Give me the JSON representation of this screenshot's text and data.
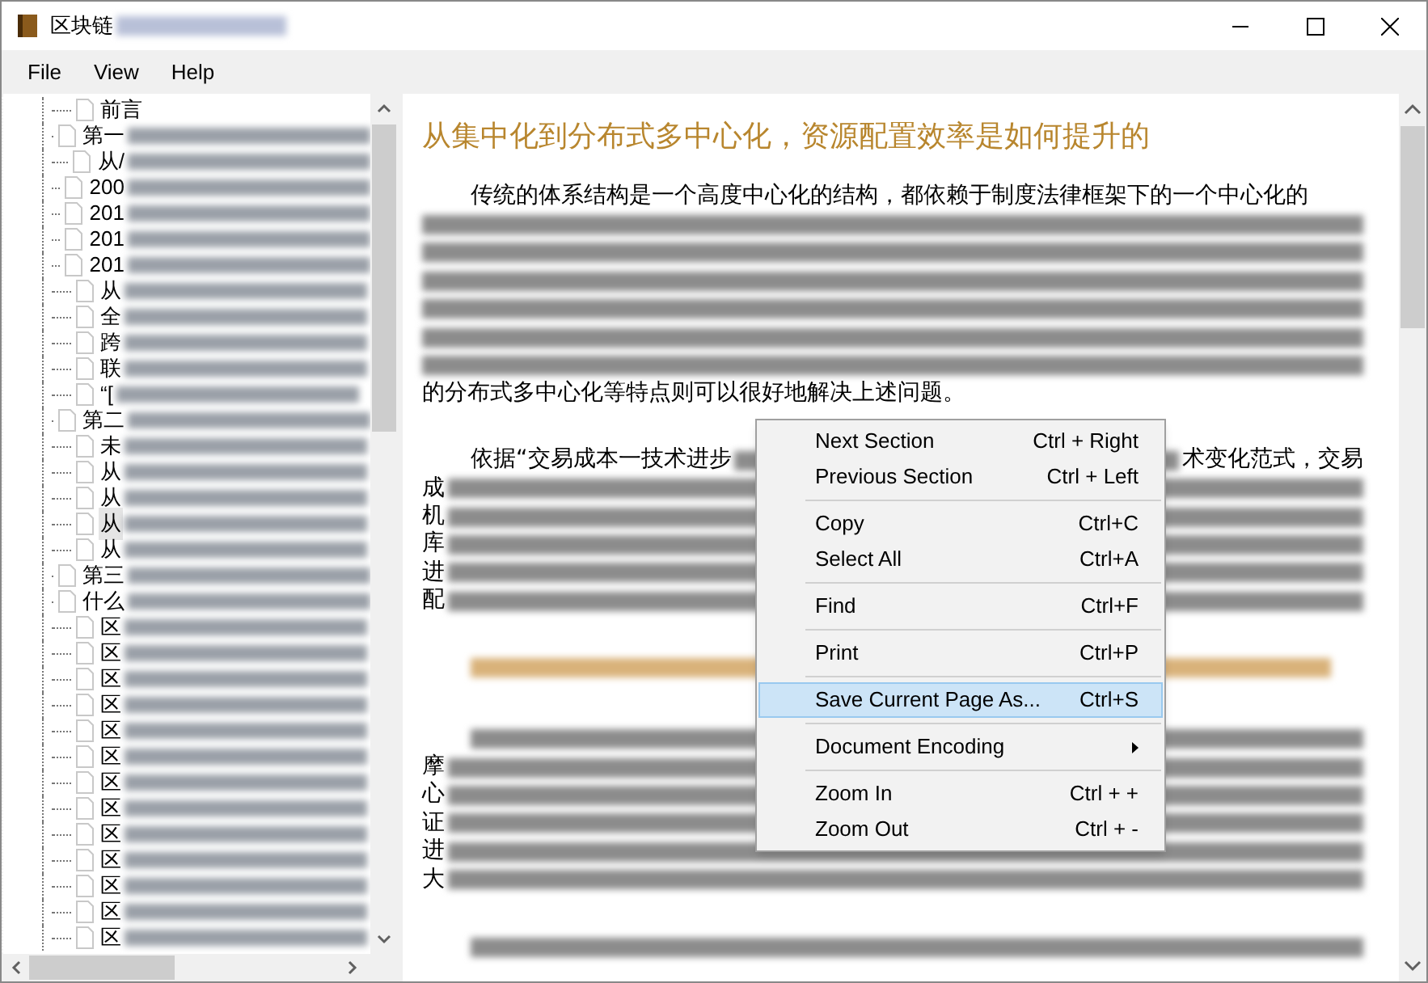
{
  "window": {
    "title": "区块链"
  },
  "menu_bar": [
    "File",
    "View",
    "Help"
  ],
  "tree": {
    "items": [
      {
        "text": "前言",
        "selected": false
      },
      {
        "text": "第一",
        "selected": false
      },
      {
        "text": "从/",
        "selected": false
      },
      {
        "text": "200",
        "selected": false
      },
      {
        "text": "201",
        "selected": false
      },
      {
        "text": "201",
        "selected": false
      },
      {
        "text": "201",
        "selected": false
      },
      {
        "text": "从",
        "selected": false
      },
      {
        "text": "全",
        "selected": false
      },
      {
        "text": "跨",
        "selected": false
      },
      {
        "text": "联",
        "selected": false
      },
      {
        "text": "“[",
        "selected": false
      },
      {
        "text": "第二",
        "selected": false
      },
      {
        "text": "未",
        "selected": false
      },
      {
        "text": "从",
        "selected": false
      },
      {
        "text": "从",
        "selected": false
      },
      {
        "text": "从",
        "selected": true
      },
      {
        "text": "从",
        "selected": false
      },
      {
        "text": "第三",
        "selected": false
      },
      {
        "text": "什么",
        "selected": false
      },
      {
        "text": "区",
        "selected": false
      },
      {
        "text": "区",
        "selected": false
      },
      {
        "text": "区",
        "selected": false
      },
      {
        "text": "区",
        "selected": false
      },
      {
        "text": "区",
        "selected": false
      },
      {
        "text": "区",
        "selected": false
      },
      {
        "text": "区",
        "selected": false
      },
      {
        "text": "区",
        "selected": false
      },
      {
        "text": "区",
        "selected": false
      },
      {
        "text": "区",
        "selected": false
      },
      {
        "text": "区",
        "selected": false
      },
      {
        "text": "区",
        "selected": false
      },
      {
        "text": "区",
        "selected": false
      }
    ]
  },
  "document": {
    "blocks": [
      {
        "kind": "heading",
        "text": "从集中化到分布式多中心化，资源配置效率是如何提升的"
      },
      {
        "kind": "paragraph",
        "lines": [
          [
            {
              "kind": "text",
              "text": "传统的体系结构是一个高度中心化的结构，都依赖于制度法律框架下的一个中心化的"
            }
          ],
          [
            {
              "kind": "blurred"
            }
          ],
          [
            {
              "kind": "blurred"
            }
          ],
          [
            {
              "kind": "blurred"
            }
          ],
          [
            {
              "kind": "blurred"
            }
          ],
          [
            {
              "kind": "blurred"
            }
          ],
          [
            {
              "kind": "blurred"
            }
          ],
          [
            {
              "kind": "text",
              "text": "的分布式多中心化等特点则可以很好地解决上述问题。"
            }
          ]
        ]
      },
      {
        "kind": "paragraph",
        "lines": [
          [
            {
              "kind": "text",
              "text": "依据“交易成本一技术进步"
            },
            {
              "kind": "blurred"
            },
            {
              "kind": "text",
              "text": "术变化范式，交易"
            }
          ],
          [
            {
              "kind": "text",
              "text": "成"
            },
            {
              "kind": "blurred"
            }
          ],
          [
            {
              "kind": "text",
              "text": "机"
            },
            {
              "kind": "blurred"
            }
          ],
          [
            {
              "kind": "text",
              "text": "库"
            },
            {
              "kind": "blurred"
            }
          ],
          [
            {
              "kind": "text",
              "text": "进"
            },
            {
              "kind": "blurred"
            }
          ],
          [
            {
              "kind": "text",
              "text": "配"
            },
            {
              "kind": "blurred"
            }
          ]
        ]
      },
      {
        "kind": "subheading"
      },
      {
        "kind": "paragraph",
        "lines": [
          [
            {
              "kind": "blurred"
            }
          ],
          [
            {
              "kind": "text",
              "text": "摩"
            },
            {
              "kind": "blurred"
            }
          ],
          [
            {
              "kind": "text",
              "text": "心"
            },
            {
              "kind": "blurred"
            }
          ],
          [
            {
              "kind": "text",
              "text": "证"
            },
            {
              "kind": "blurred"
            }
          ],
          [
            {
              "kind": "text",
              "text": "进"
            },
            {
              "kind": "blurred"
            }
          ],
          [
            {
              "kind": "text",
              "text": "大"
            },
            {
              "kind": "blurred"
            }
          ]
        ]
      },
      {
        "kind": "paragraph",
        "lines": [
          [
            {
              "kind": "blurred"
            }
          ]
        ]
      }
    ]
  },
  "context_menu": {
    "groups": [
      [
        {
          "label": "Next Section",
          "shortcut": "Ctrl + Right",
          "selected": false
        },
        {
          "label": "Previous Section",
          "shortcut": "Ctrl + Left",
          "selected": false
        }
      ],
      [
        {
          "label": "Copy",
          "shortcut": "Ctrl+C",
          "selected": false
        },
        {
          "label": "Select All",
          "shortcut": "Ctrl+A",
          "selected": false
        }
      ],
      [
        {
          "label": "Find",
          "shortcut": "Ctrl+F",
          "selected": false
        }
      ],
      [
        {
          "label": "Print",
          "shortcut": "Ctrl+P",
          "selected": false
        }
      ],
      [
        {
          "label": "Save Current Page As...",
          "shortcut": "Ctrl+S",
          "selected": true
        }
      ],
      [
        {
          "label": "Document Encoding",
          "submenu": true,
          "selected": false
        }
      ],
      [
        {
          "label": "Zoom In",
          "shortcut": "Ctrl + +",
          "selected": false
        },
        {
          "label": "Zoom Out",
          "shortcut": "Ctrl + -",
          "selected": false
        }
      ]
    ]
  }
}
